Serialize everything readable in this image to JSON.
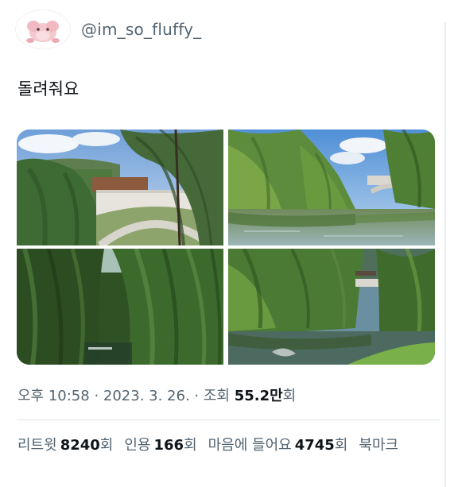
{
  "author": {
    "handle": "@im_so_fluffy_",
    "avatar_icon": "pink-plush-avatar"
  },
  "tweet": {
    "text": "돌려줘요"
  },
  "media": {
    "photos": [
      {
        "label": "stone-bridge-with-willows-photo"
      },
      {
        "label": "river-with-willows-and-bridge-photo"
      },
      {
        "label": "dense-willow-trees-photo"
      },
      {
        "label": "willow-riverbank-with-bridge-photo"
      }
    ]
  },
  "meta": {
    "time": "오후 10:58",
    "sep1": " · ",
    "date": "2023. 3. 26.",
    "sep2": " · ",
    "views_label": "조회 ",
    "views_count": "55.2만",
    "views_suffix": "회"
  },
  "stats": {
    "retweets_label": "리트윗",
    "retweets_count": "8240",
    "retweets_suffix": "회",
    "quotes_label": "인용",
    "quotes_count": "166",
    "quotes_suffix": "회",
    "likes_label": "마음에 들어요",
    "likes_count": "4745",
    "likes_suffix": "회",
    "bookmarks_label": "북마크"
  }
}
